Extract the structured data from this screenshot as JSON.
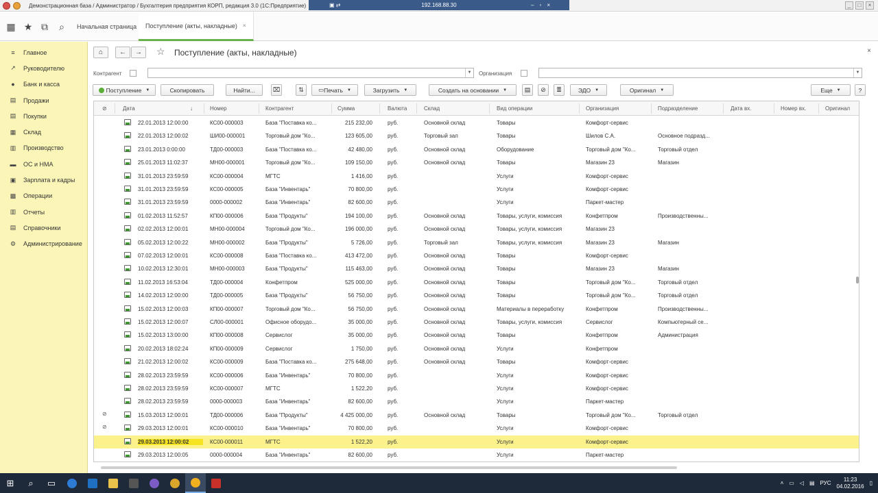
{
  "window": {
    "title": "Демонстрационная база / Администратор / Бухгалтерия предприятия КОРП, редакция 3.0  (1С:Предприятие)",
    "remote_address": "192.168.88.30"
  },
  "top_tabs": [
    {
      "label": "Начальная страница"
    },
    {
      "label": "Поступление (акты, накладные)",
      "close": "×"
    }
  ],
  "sidebar": {
    "items": [
      {
        "label": "Главное",
        "icon": "≡"
      },
      {
        "label": "Руководителю",
        "icon": "↗"
      },
      {
        "label": "Банк и касса",
        "icon": "●"
      },
      {
        "label": "Продажи",
        "icon": "▤"
      },
      {
        "label": "Покупки",
        "icon": "▤"
      },
      {
        "label": "Склад",
        "icon": "▦"
      },
      {
        "label": "Производство",
        "icon": "▥"
      },
      {
        "label": "ОС и НМА",
        "icon": "▬"
      },
      {
        "label": "Зарплата и кадры",
        "icon": "▣"
      },
      {
        "label": "Операции",
        "icon": "▩"
      },
      {
        "label": "Отчеты",
        "icon": "▥"
      },
      {
        "label": "Справочники",
        "icon": "▤"
      },
      {
        "label": "Администрирование",
        "icon": "⚙"
      }
    ]
  },
  "form": {
    "title": "Поступление (акты, накладные)",
    "filter_contractor_label": "Контрагент",
    "filter_org_label": "Организация"
  },
  "toolbar": {
    "receipt": "Поступление",
    "copy": "Скопировать",
    "find": "Найти...",
    "print": "Печать",
    "load": "Загрузить",
    "create_based": "Создать на основании",
    "edo": "ЭДО",
    "original": "Оригинал",
    "more": "Еще",
    "help": "?"
  },
  "columns": [
    "Дата",
    "Номер",
    "Контрагент",
    "Сумма",
    "Валюта",
    "Склад",
    "Вид операции",
    "Организация",
    "Подразделение",
    "Дата вх.",
    "Номер вх.",
    "Оригинал"
  ],
  "rows": [
    {
      "date": "22.01.2013 12:00:00",
      "num": "КС00-000003",
      "contr": "База \"Поставка ко...",
      "sum": "215 232,00",
      "cur": "руб.",
      "wh": "Основной склад",
      "op": "Товары",
      "org": "Комфорт-сервис",
      "dept": "",
      "clip": ""
    },
    {
      "date": "22.01.2013 12:00:02",
      "num": "ШИ00-000001",
      "contr": "Торговый дом \"Ко...",
      "sum": "123 605,00",
      "cur": "руб.",
      "wh": "Торговый зал",
      "op": "Товары",
      "org": "Шилов С.А.",
      "dept": "Основное подразд...",
      "clip": ""
    },
    {
      "date": "23.01.2013 0:00:00",
      "num": "ТД00-000003",
      "contr": "База \"Поставка ко...",
      "sum": "42 480,00",
      "cur": "руб.",
      "wh": "Основной склад",
      "op": "Оборудование",
      "org": "Торговый дом \"Ко...",
      "dept": "Торговый отдел",
      "clip": ""
    },
    {
      "date": "25.01.2013 11:02:37",
      "num": "МН00-000001",
      "contr": "Торговый дом \"Ко...",
      "sum": "109 150,00",
      "cur": "руб.",
      "wh": "Основной склад",
      "op": "Товары",
      "org": "Магазин 23",
      "dept": "Магазин",
      "clip": ""
    },
    {
      "date": "31.01.2013 23:59:59",
      "num": "КС00-000004",
      "contr": "МГТС",
      "sum": "1 416,00",
      "cur": "руб.",
      "wh": "",
      "op": "Услуги",
      "org": "Комфорт-сервис",
      "dept": "",
      "clip": ""
    },
    {
      "date": "31.01.2013 23:59:59",
      "num": "КС00-000005",
      "contr": "База \"Инвентарь\"",
      "sum": "70 800,00",
      "cur": "руб.",
      "wh": "",
      "op": "Услуги",
      "org": "Комфорт-сервис",
      "dept": "",
      "clip": ""
    },
    {
      "date": "31.01.2013 23:59:59",
      "num": "0000-000002",
      "contr": "База \"Инвентарь\"",
      "sum": "82 600,00",
      "cur": "руб.",
      "wh": "",
      "op": "Услуги",
      "org": "Паркет-мастер",
      "dept": "",
      "clip": ""
    },
    {
      "date": "01.02.2013 11:52:57",
      "num": "КП00-000006",
      "contr": "База \"Продукты\"",
      "sum": "194 100,00",
      "cur": "руб.",
      "wh": "Основной склад",
      "op": "Товары, услуги, комиссия",
      "org": "Конфетпром",
      "dept": "Производственны...",
      "clip": ""
    },
    {
      "date": "02.02.2013 12:00:01",
      "num": "МН00-000004",
      "contr": "Торговый дом \"Ко...",
      "sum": "196 000,00",
      "cur": "руб.",
      "wh": "Основной склад",
      "op": "Товары, услуги, комиссия",
      "org": "Магазин 23",
      "dept": "",
      "clip": ""
    },
    {
      "date": "05.02.2013 12:00:22",
      "num": "МН00-000002",
      "contr": "База \"Продукты\"",
      "sum": "5 726,00",
      "cur": "руб.",
      "wh": "Торговый зал",
      "op": "Товары, услуги, комиссия",
      "org": "Магазин 23",
      "dept": "Магазин",
      "clip": ""
    },
    {
      "date": "07.02.2013 12:00:01",
      "num": "КС00-000008",
      "contr": "База \"Поставка ко...",
      "sum": "413 472,00",
      "cur": "руб.",
      "wh": "Основной склад",
      "op": "Товары",
      "org": "Комфорт-сервис",
      "dept": "",
      "clip": ""
    },
    {
      "date": "10.02.2013 12:30:01",
      "num": "МН00-000003",
      "contr": "База \"Продукты\"",
      "sum": "115 463,00",
      "cur": "руб.",
      "wh": "Основной склад",
      "op": "Товары",
      "org": "Магазин 23",
      "dept": "Магазин",
      "clip": ""
    },
    {
      "date": "11.02.2013 16:53:04",
      "num": "ТД00-000004",
      "contr": "Конфетпром",
      "sum": "525 000,00",
      "cur": "руб.",
      "wh": "Основной склад",
      "op": "Товары",
      "org": "Торговый дом \"Ко...",
      "dept": "Торговый отдел",
      "clip": ""
    },
    {
      "date": "14.02.2013 12:00:00",
      "num": "ТД00-000005",
      "contr": "База \"Продукты\"",
      "sum": "56 750,00",
      "cur": "руб.",
      "wh": "Основной склад",
      "op": "Товары",
      "org": "Торговый дом \"Ко...",
      "dept": "Торговый отдел",
      "clip": ""
    },
    {
      "date": "15.02.2013 12:00:03",
      "num": "КП00-000007",
      "contr": "Торговый дом \"Ко...",
      "sum": "56 750,00",
      "cur": "руб.",
      "wh": "Основной склад",
      "op": "Материалы в переработку",
      "org": "Конфетпром",
      "dept": "Производственны...",
      "clip": ""
    },
    {
      "date": "15.02.2013 12:00:07",
      "num": "СЛ00-000001",
      "contr": "Офисное оборудо...",
      "sum": "35 000,00",
      "cur": "руб.",
      "wh": "Основной склад",
      "op": "Товары, услуги, комиссия",
      "org": "Сервислог",
      "dept": "Компьютерный се...",
      "clip": ""
    },
    {
      "date": "15.02.2013 13:00:00",
      "num": "КП00-000008",
      "contr": "Сервислог",
      "sum": "35 000,00",
      "cur": "руб.",
      "wh": "Основной склад",
      "op": "Товары",
      "org": "Конфетпром",
      "dept": "Администрация",
      "clip": ""
    },
    {
      "date": "20.02.2013 18:02:24",
      "num": "КП00-000009",
      "contr": "Сервислог",
      "sum": "1 750,00",
      "cur": "руб.",
      "wh": "Основной склад",
      "op": "Услуги",
      "org": "Конфетпром",
      "dept": "",
      "clip": ""
    },
    {
      "date": "21.02.2013 12:00:02",
      "num": "КС00-000009",
      "contr": "База \"Поставка ко...",
      "sum": "275 648,00",
      "cur": "руб.",
      "wh": "Основной склад",
      "op": "Товары",
      "org": "Комфорт-сервис",
      "dept": "",
      "clip": ""
    },
    {
      "date": "28.02.2013 23:59:59",
      "num": "КС00-000006",
      "contr": "База \"Инвентарь\"",
      "sum": "70 800,00",
      "cur": "руб.",
      "wh": "",
      "op": "Услуги",
      "org": "Комфорт-сервис",
      "dept": "",
      "clip": ""
    },
    {
      "date": "28.02.2013 23:59:59",
      "num": "КС00-000007",
      "contr": "МГТС",
      "sum": "1 522,20",
      "cur": "руб.",
      "wh": "",
      "op": "Услуги",
      "org": "Комфорт-сервис",
      "dept": "",
      "clip": ""
    },
    {
      "date": "28.02.2013 23:59:59",
      "num": "0000-000003",
      "contr": "База \"Инвентарь\"",
      "sum": "82 600,00",
      "cur": "руб.",
      "wh": "",
      "op": "Услуги",
      "org": "Паркет-мастер",
      "dept": "",
      "clip": ""
    },
    {
      "date": "15.03.2013 12:00:01",
      "num": "ТД00-000006",
      "contr": "База \"Продукты\"",
      "sum": "4 425 000,00",
      "cur": "руб.",
      "wh": "Основной склад",
      "op": "Товары",
      "org": "Торговый дом \"Ко...",
      "dept": "Торговый отдел",
      "clip": "⊘"
    },
    {
      "date": "29.03.2013 12:00:01",
      "num": "КС00-000010",
      "contr": "База \"Инвентарь\"",
      "sum": "70 800,00",
      "cur": "руб.",
      "wh": "",
      "op": "Услуги",
      "org": "Комфорт-сервис",
      "dept": "",
      "clip": "⊘"
    },
    {
      "date": "29.03.2013 12:00:02",
      "num": "КС00-000011",
      "contr": "МГТС",
      "sum": "1 522,20",
      "cur": "руб.",
      "wh": "",
      "op": "Услуги",
      "org": "Комфорт-сервис",
      "dept": "",
      "clip": "",
      "selected": true
    },
    {
      "date": "29.03.2013 12:00:05",
      "num": "0000-000004",
      "contr": "База \"Инвентарь\"",
      "sum": "82 600,00",
      "cur": "руб.",
      "wh": "",
      "op": "Услуги",
      "org": "Паркет-мастер",
      "dept": "",
      "clip": ""
    }
  ],
  "taskbar": {
    "lang": "РУС",
    "time": "11:23",
    "date": "04.02.2016"
  }
}
